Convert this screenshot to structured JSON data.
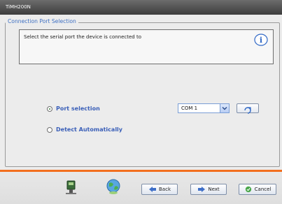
{
  "window": {
    "title": "TiMH200N"
  },
  "group": {
    "title": "Connection Port Selection"
  },
  "info": {
    "text": "Select the serial port the device is connected to",
    "icon": "info-icon"
  },
  "options": {
    "port_selection": {
      "label": "Port selection",
      "checked": true
    },
    "detect_auto": {
      "label": "Detect Automatically",
      "checked": false
    }
  },
  "port": {
    "selected": "COM 1"
  },
  "buttons": {
    "back": "Back",
    "next": "Next",
    "cancel": "Cancel"
  },
  "colors": {
    "accent_orange": "#f36f1f",
    "label_blue": "#3a5fb8",
    "legend_blue": "#3d6fc2"
  }
}
